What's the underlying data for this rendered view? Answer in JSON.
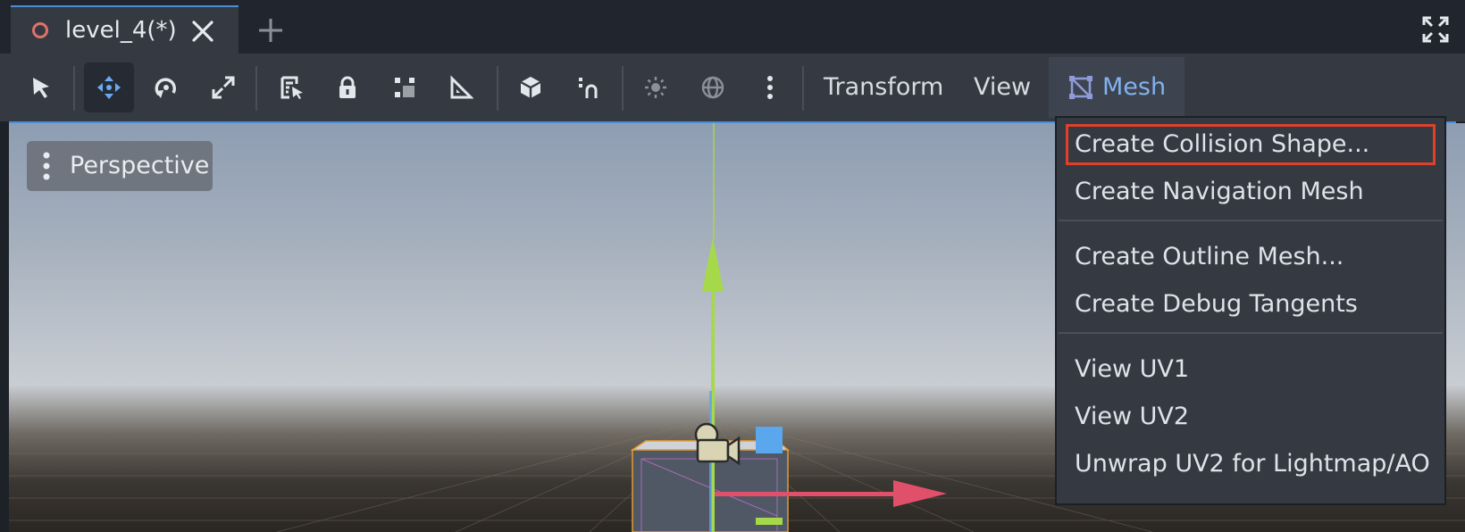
{
  "tabs": [
    {
      "title": "level_4(*)",
      "active": true
    }
  ],
  "tabbar": {
    "close_icon": "close-icon",
    "add_icon": "plus-icon",
    "fullscreen_icon": "fullscreen-icon"
  },
  "toolbar": {
    "tools": [
      {
        "name": "select-tool",
        "icon": "cursor-icon",
        "active": false
      },
      {
        "name": "move-tool",
        "icon": "move-arrows-icon",
        "active": true
      },
      {
        "name": "rotate-tool",
        "icon": "rotate-icon",
        "active": false
      },
      {
        "name": "scale-tool",
        "icon": "scale-icon",
        "active": false
      },
      {
        "name": "list-select-tool",
        "icon": "list-select-icon",
        "active": false
      },
      {
        "name": "lock-tool",
        "icon": "lock-icon",
        "active": false
      },
      {
        "name": "group-tool",
        "icon": "group-icon",
        "active": false
      },
      {
        "name": "ruler-tool",
        "icon": "ruler-icon",
        "active": false
      },
      {
        "name": "local-space-tool",
        "icon": "cube-icon",
        "active": false
      },
      {
        "name": "snap-tool",
        "icon": "snap-icon",
        "active": false
      },
      {
        "name": "sun-toggle",
        "icon": "sun-icon",
        "active": false
      },
      {
        "name": "environment-toggle",
        "icon": "globe-icon",
        "active": false
      },
      {
        "name": "more-options",
        "icon": "vertical-dots-icon",
        "active": false
      }
    ],
    "menus": {
      "transform": "Transform",
      "view": "View",
      "mesh": "Mesh"
    }
  },
  "viewport": {
    "perspective_label": "Perspective"
  },
  "mesh_dropdown": {
    "groups": [
      [
        "Create Collision Shape...",
        "Create Navigation Mesh"
      ],
      [
        "Create Outline Mesh...",
        "Create Debug Tangents"
      ],
      [
        "View UV1",
        "View UV2",
        "Unwrap UV2 for Lightmap/AO"
      ]
    ],
    "highlighted_item": "Create Collision Shape..."
  },
  "colors": {
    "accent_blue": "#4a8fd6",
    "mesh_menu_text": "#82b2ee",
    "highlight_red": "#e0402a",
    "gizmo_y": "#a6d94a",
    "gizmo_x": "#e0506a",
    "gizmo_z": "#5aa7ee"
  }
}
